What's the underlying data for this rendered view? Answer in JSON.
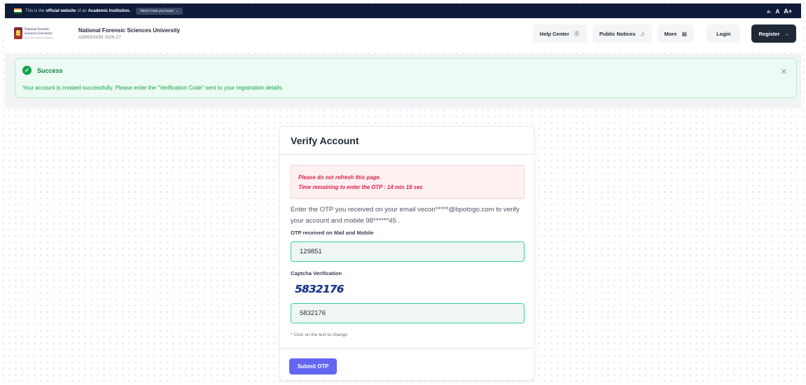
{
  "gov_bar": {
    "prefix": "This is the",
    "official": "official website",
    "middle": "of an",
    "institution": "Academic Institution.",
    "know_button": "Here's how you know",
    "font_small": "A-",
    "font_normal": "A",
    "font_large": "A+"
  },
  "header": {
    "logo_line1": "National Forensic",
    "logo_line2": "Sciences University",
    "logo_sub": "Knowledge | Wisdom | Fulfilment",
    "org_name": "National Forensic Sciences University",
    "org_sub": "ADMISSION 2026-27",
    "nav": {
      "help_center": "Help Center",
      "public_notices": "Public Notices",
      "more": "More",
      "login": "Login",
      "register": "Register"
    },
    "icons": {
      "help": "question-circle-icon",
      "notices": "bell-icon",
      "more": "grid-icon",
      "register": "arrow-right-icon"
    }
  },
  "alert": {
    "title": "Success",
    "message": "Your account is created successfully. Please enter the \"Verification Code\" sent to your registration details.",
    "close_icon": "close-icon",
    "status_color": "#16a34a"
  },
  "verify_card": {
    "title": "Verify Account",
    "warning_line1": "Please do not refresh this page.",
    "warning_line2": "Time remaining to enter the OTP : 14 min 16 sec",
    "info": "Enter the OTP you received on your email vecon*****@bpotogo.com to verify your account and mobile 98******45 .",
    "otp_label": "OTP received on Mail and Mobile",
    "otp_value": "129851",
    "captcha_label": "Captcha Verification",
    "captcha_image_text": "5832176",
    "captcha_value": "5832176",
    "hint": "* Click on the text to change",
    "submit_label": "Submit OTP"
  },
  "colors": {
    "accent": "#6366f1",
    "input_border": "#34d399",
    "warning": "#e11d48",
    "dark_button": "#1f2937"
  }
}
